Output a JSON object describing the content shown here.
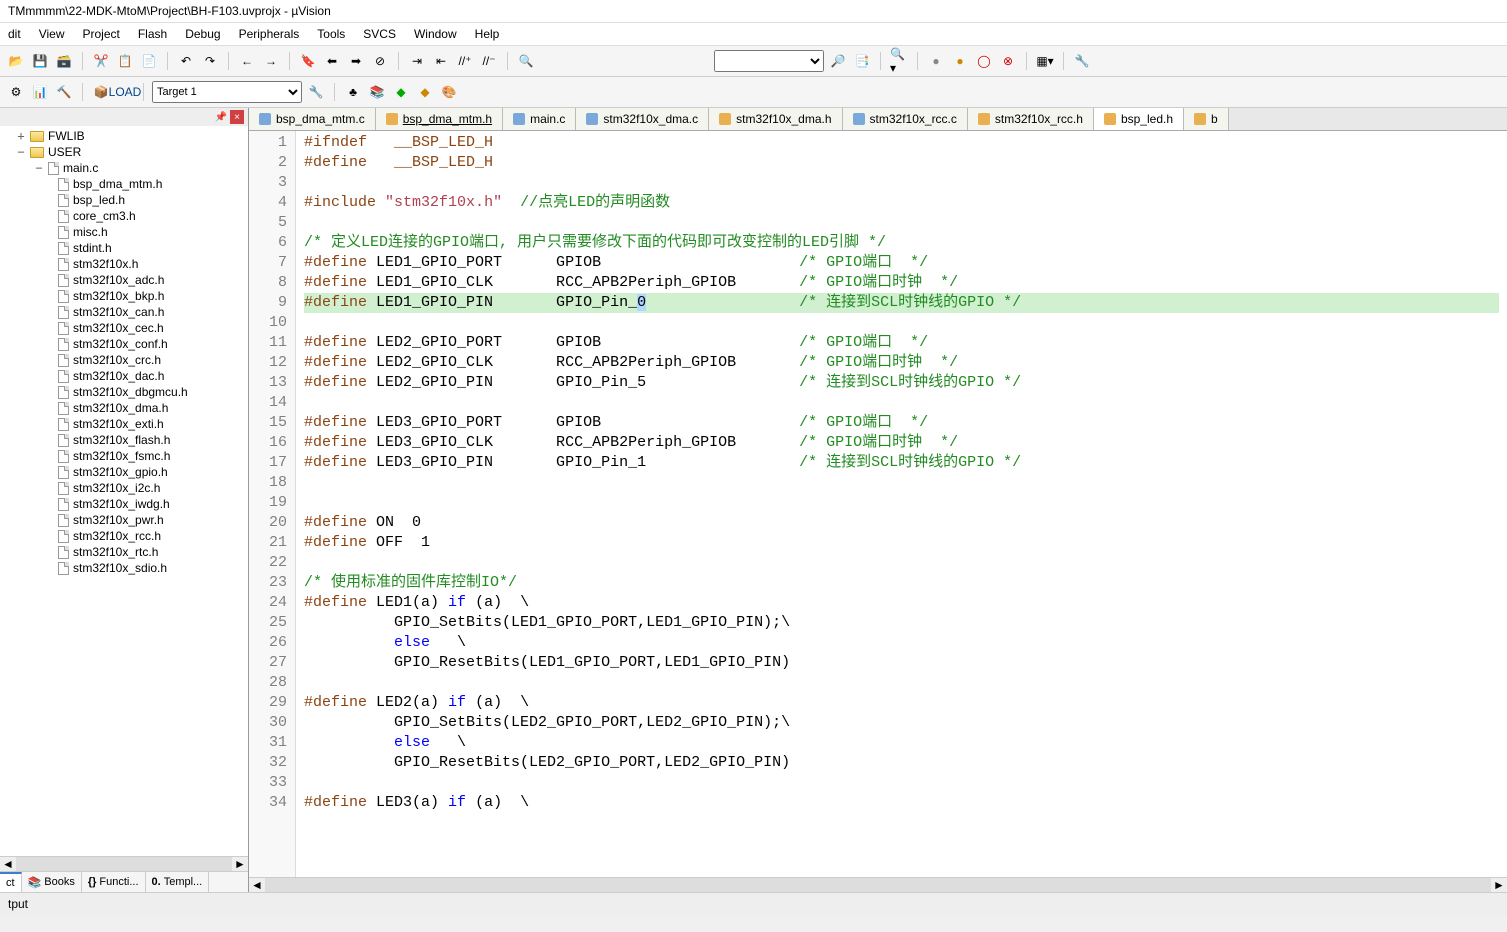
{
  "title": "TMmmmm\\22-MDK-MtoM\\Project\\BH-F103.uvprojx - µVision",
  "menu": [
    "dit",
    "View",
    "Project",
    "Flash",
    "Debug",
    "Peripherals",
    "Tools",
    "SVCS",
    "Window",
    "Help"
  ],
  "target_select": "Target 1",
  "tree": {
    "root1": "FWLIB",
    "root2": "USER",
    "main": "main.c",
    "files": [
      "bsp_dma_mtm.h",
      "bsp_led.h",
      "core_cm3.h",
      "misc.h",
      "stdint.h",
      "stm32f10x.h",
      "stm32f10x_adc.h",
      "stm32f10x_bkp.h",
      "stm32f10x_can.h",
      "stm32f10x_cec.h",
      "stm32f10x_conf.h",
      "stm32f10x_crc.h",
      "stm32f10x_dac.h",
      "stm32f10x_dbgmcu.h",
      "stm32f10x_dma.h",
      "stm32f10x_exti.h",
      "stm32f10x_flash.h",
      "stm32f10x_fsmc.h",
      "stm32f10x_gpio.h",
      "stm32f10x_i2c.h",
      "stm32f10x_iwdg.h",
      "stm32f10x_pwr.h",
      "stm32f10x_rcc.h",
      "stm32f10x_rtc.h",
      "stm32f10x_sdio.h"
    ]
  },
  "panel_tabs": {
    "t0": "ct",
    "t1": "Books",
    "t2": "Functi...",
    "t3": "Templ..."
  },
  "editor_tabs": [
    {
      "name": "bsp_dma_mtm.c",
      "kind": "c"
    },
    {
      "name": "bsp_dma_mtm.h",
      "kind": "h",
      "mod": true
    },
    {
      "name": "main.c",
      "kind": "c"
    },
    {
      "name": "stm32f10x_dma.c",
      "kind": "c"
    },
    {
      "name": "stm32f10x_dma.h",
      "kind": "h"
    },
    {
      "name": "stm32f10x_rcc.c",
      "kind": "c"
    },
    {
      "name": "stm32f10x_rcc.h",
      "kind": "h"
    },
    {
      "name": "bsp_led.h",
      "kind": "h",
      "active": true
    },
    {
      "name": "b",
      "kind": "h"
    }
  ],
  "code_lines": [
    {
      "n": 1,
      "t": "pp",
      "s": "#ifndef   __BSP_LED_H"
    },
    {
      "n": 2,
      "t": "pp",
      "s": "#define   __BSP_LED_H"
    },
    {
      "n": 3,
      "t": "",
      "s": ""
    },
    {
      "n": 4,
      "t": "mix",
      "s": "#include \"stm32f10x.h\"  //点亮LED的声明函数"
    },
    {
      "n": 5,
      "t": "",
      "s": ""
    },
    {
      "n": 6,
      "t": "cmt",
      "s": "/* 定义LED连接的GPIO端口, 用户只需要修改下面的代码即可改变控制的LED引脚 */"
    },
    {
      "n": 7,
      "t": "def",
      "s": "#define LED1_GPIO_PORT      GPIOB                      /* GPIO端口  */"
    },
    {
      "n": 8,
      "t": "def",
      "s": "#define LED1_GPIO_CLK       RCC_APB2Periph_GPIOB       /* GPIO端口时钟  */"
    },
    {
      "n": 9,
      "t": "defhl",
      "s": "#define LED1_GPIO_PIN       GPIO_Pin_0                 /* 连接到SCL时钟线的GPIO */"
    },
    {
      "n": 10,
      "t": "",
      "s": ""
    },
    {
      "n": 11,
      "t": "def",
      "s": "#define LED2_GPIO_PORT      GPIOB                      /* GPIO端口  */"
    },
    {
      "n": 12,
      "t": "def",
      "s": "#define LED2_GPIO_CLK       RCC_APB2Periph_GPIOB       /* GPIO端口时钟  */"
    },
    {
      "n": 13,
      "t": "def",
      "s": "#define LED2_GPIO_PIN       GPIO_Pin_5                 /* 连接到SCL时钟线的GPIO */"
    },
    {
      "n": 14,
      "t": "",
      "s": ""
    },
    {
      "n": 15,
      "t": "def",
      "s": "#define LED3_GPIO_PORT      GPIOB                      /* GPIO端口  */"
    },
    {
      "n": 16,
      "t": "def",
      "s": "#define LED3_GPIO_CLK       RCC_APB2Periph_GPIOB       /* GPIO端口时钟  */"
    },
    {
      "n": 17,
      "t": "def",
      "s": "#define LED3_GPIO_PIN       GPIO_Pin_1                 /* 连接到SCL时钟线的GPIO */"
    },
    {
      "n": 18,
      "t": "",
      "s": ""
    },
    {
      "n": 19,
      "t": "",
      "s": ""
    },
    {
      "n": 20,
      "t": "def2",
      "s": "#define ON  0"
    },
    {
      "n": 21,
      "t": "def2",
      "s": "#define OFF 1"
    },
    {
      "n": 22,
      "t": "",
      "s": ""
    },
    {
      "n": 23,
      "t": "cmt",
      "s": "/* 使用标准的固件库控制IO*/"
    },
    {
      "n": 24,
      "t": "mac",
      "s": "#define LED1(a) if (a)  \\"
    },
    {
      "n": 25,
      "t": "plain",
      "s": "          GPIO_SetBits(LED1_GPIO_PORT,LED1_GPIO_PIN);\\"
    },
    {
      "n": 26,
      "t": "kw",
      "s": "          else   \\"
    },
    {
      "n": 27,
      "t": "plain",
      "s": "          GPIO_ResetBits(LED1_GPIO_PORT,LED1_GPIO_PIN)"
    },
    {
      "n": 28,
      "t": "",
      "s": ""
    },
    {
      "n": 29,
      "t": "mac",
      "s": "#define LED2(a) if (a)  \\"
    },
    {
      "n": 30,
      "t": "plain",
      "s": "          GPIO_SetBits(LED2_GPIO_PORT,LED2_GPIO_PIN);\\"
    },
    {
      "n": 31,
      "t": "kw",
      "s": "          else   \\"
    },
    {
      "n": 32,
      "t": "plain",
      "s": "          GPIO_ResetBits(LED2_GPIO_PORT,LED2_GPIO_PIN)"
    },
    {
      "n": 33,
      "t": "",
      "s": ""
    },
    {
      "n": 34,
      "t": "mac",
      "s": "#define LED3(a) if (a)  \\"
    }
  ],
  "status": "tput"
}
